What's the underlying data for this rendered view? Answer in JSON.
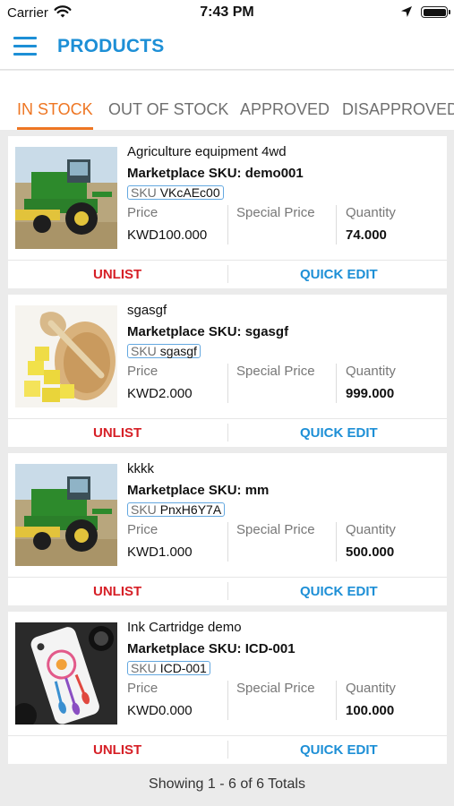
{
  "status_bar": {
    "carrier": "Carrier",
    "time": "7:43 PM"
  },
  "header": {
    "title": "PRODUCTS"
  },
  "tabs": [
    {
      "label": "IN STOCK",
      "active": true
    },
    {
      "label": "OUT OF STOCK",
      "active": false
    },
    {
      "label": "APPROVED",
      "active": false
    },
    {
      "label": "DISAPPROVED",
      "active": false
    }
  ],
  "columns": {
    "price": "Price",
    "special_price": "Special Price",
    "quantity": "Quantity"
  },
  "actions": {
    "unlist": "UNLIST",
    "quick_edit": "QUICK EDIT"
  },
  "sku_prefix": "SKU",
  "products": [
    {
      "name": "Agriculture equipment 4wd",
      "marketplace_sku": "Marketplace SKU: demo001",
      "sku": "VKcAEc00",
      "price": "KWD100.000",
      "special_price": "",
      "quantity": "74.000",
      "image_icon": "harvester-image"
    },
    {
      "name": "sgasgf",
      "marketplace_sku": "Marketplace SKU: sgasgf",
      "sku": "sgasgf",
      "price": "KWD2.000",
      "special_price": "",
      "quantity": "999.000",
      "image_icon": "ginger-image"
    },
    {
      "name": "kkkk",
      "marketplace_sku": "Marketplace SKU: mm",
      "sku": "PnxH6Y7A",
      "price": "KWD1.000",
      "special_price": "",
      "quantity": "500.000",
      "image_icon": "harvester-image"
    },
    {
      "name": "Ink Cartridge demo",
      "marketplace_sku": "Marketplace SKU: ICD-001",
      "sku": "ICD-001",
      "price": "KWD0.000",
      "special_price": "",
      "quantity": "100.000",
      "image_icon": "phone-case-image"
    }
  ],
  "footer": {
    "summary": "Showing 1 - 6 of 6 Totals"
  },
  "colors": {
    "accent_blue": "#1d8fd6",
    "accent_orange": "#ee7623",
    "unlist_red": "#d61f26",
    "background": "#ebebeb"
  }
}
